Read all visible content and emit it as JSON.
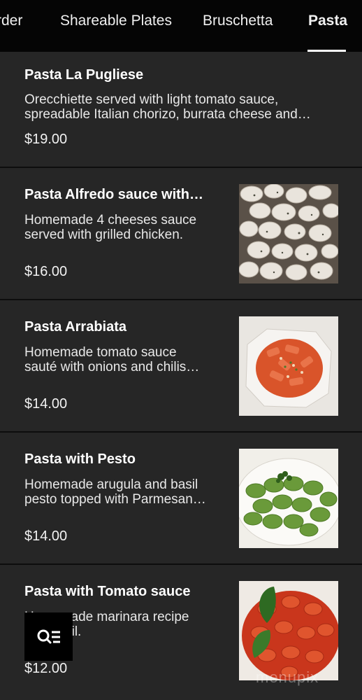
{
  "tabs": [
    {
      "label": "rder",
      "active": false
    },
    {
      "label": "Shareable Plates",
      "active": false
    },
    {
      "label": "Bruschetta",
      "active": false
    },
    {
      "label": "Pasta",
      "active": true
    }
  ],
  "items": [
    {
      "name": "Pasta La Pugliese",
      "description_line1": "Orecchiette served with light tomato sauce,",
      "description_line2": "spreadable Italian chorizo, burrata cheese and…",
      "price": "$19.00",
      "image": "none"
    },
    {
      "name": "Pasta Alfredo sauce with…",
      "description_line1": "Homemade 4 cheeses sauce",
      "description_line2": "served with grilled chicken.",
      "price": "$16.00",
      "image": "creamy-pasta-photo"
    },
    {
      "name": "Pasta Arrabiata",
      "description_line1": "Homemade tomato sauce",
      "description_line2": "sauté with onions and chilis…",
      "price": "$14.00",
      "image": "arrabiata-pasta-photo"
    },
    {
      "name": "Pasta with Pesto",
      "description_line1": "Homemade arugula and basil",
      "description_line2": "pesto topped with Parmesan…",
      "price": "$14.00",
      "image": "pesto-pasta-photo"
    },
    {
      "name": "Pasta with Tomato sauce",
      "description_line1": "Homemade marinara recipe",
      "description_line2": "and basil.",
      "price": "$12.00",
      "image": "tomato-pasta-photo"
    }
  ],
  "fab": {
    "icon": "search-list-icon"
  },
  "watermark": "menupix",
  "colors": {
    "background": "#262626",
    "tabbar": "#050505",
    "text": "#ffffff"
  }
}
